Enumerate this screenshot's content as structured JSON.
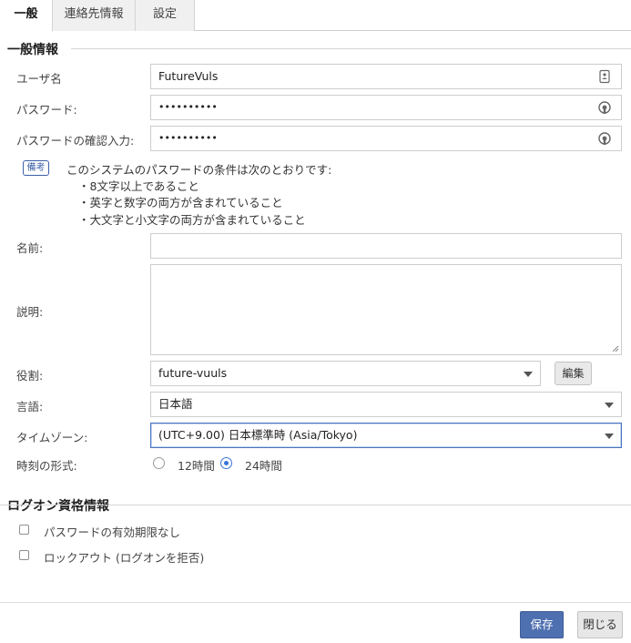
{
  "tabs": [
    {
      "label": "一般",
      "active": true
    },
    {
      "label": "連絡先情報",
      "active": false
    },
    {
      "label": "設定",
      "active": false
    }
  ],
  "general": {
    "title": "一般情報",
    "username": {
      "label": "ユーザ名",
      "value": "FutureVuls",
      "icon": "contact-card-icon"
    },
    "password": {
      "label": "パスワード:",
      "value": "••••••••••",
      "icon": "password-reveal-icon"
    },
    "password_confirm": {
      "label": "パスワードの確認入力:",
      "value": "••••••••••",
      "icon": "password-reveal-icon"
    },
    "note": {
      "badge": "備考",
      "lines": [
        "このシステムのパスワードの条件は次のとおりです:",
        "・8文字以上であること",
        "・英字と数字の両方が含まれていること",
        "・大文字と小文字の両方が含まれていること"
      ]
    },
    "name": {
      "label": "名前:",
      "value": ""
    },
    "description": {
      "label": "説明:",
      "value": ""
    },
    "role": {
      "label": "役割:",
      "value": "future-vuuls",
      "edit_label": "編集"
    },
    "language": {
      "label": "言語:",
      "value": "日本語"
    },
    "timezone": {
      "label": "タイムゾーン:",
      "value": "(UTC+9.00) 日本標準時 (Asia/Tokyo)"
    },
    "time_format": {
      "label": "時刻の形式:",
      "options": [
        {
          "label": "12時間",
          "selected": false
        },
        {
          "label": "24時間",
          "selected": true
        }
      ]
    }
  },
  "logon": {
    "title": "ログオン資格情報",
    "options": [
      {
        "label": "パスワードの有効期限なし",
        "checked": false
      },
      {
        "label": "ロックアウト (ログオンを拒否)",
        "checked": false
      }
    ]
  },
  "footer": {
    "save_label": "保存",
    "close_label": "閉じる"
  },
  "colors": {
    "primary": "#4e6fb0",
    "focus": "#4a74c0",
    "radio": "#3b73d6"
  }
}
